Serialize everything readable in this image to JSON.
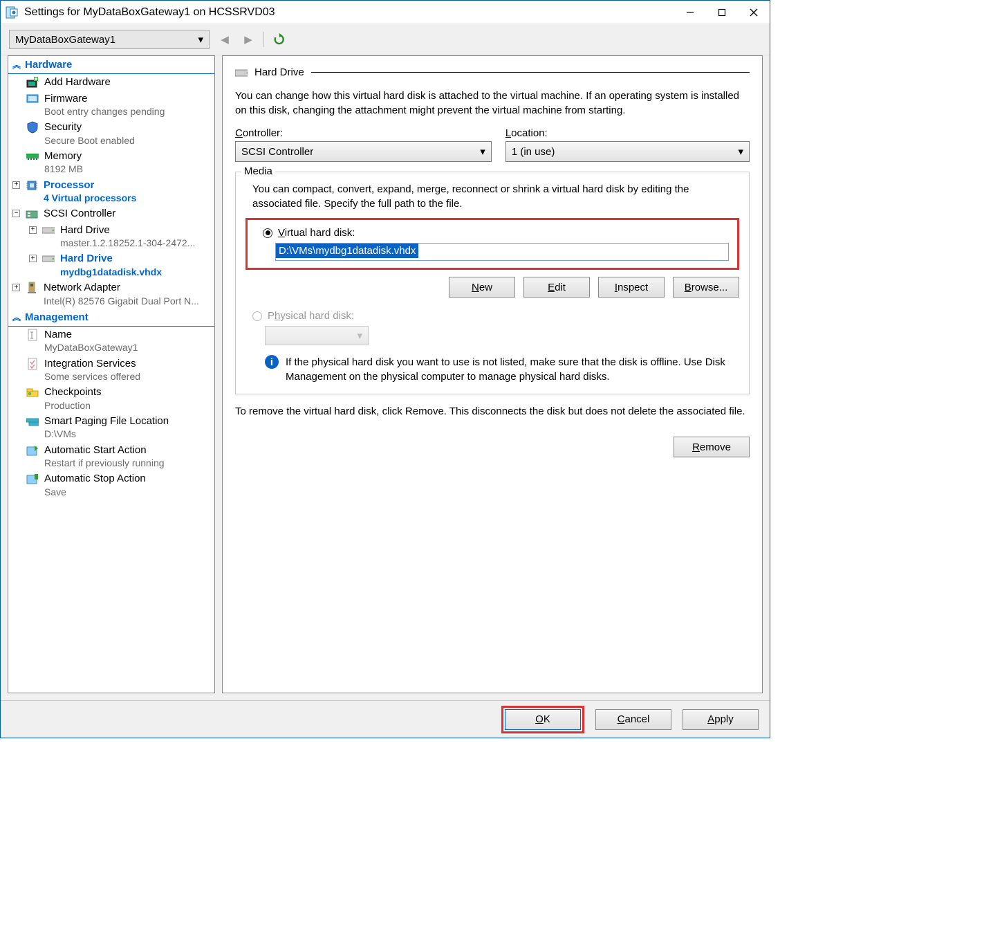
{
  "title": "Settings for MyDataBoxGateway1 on HCSSRVD03",
  "vm_selector": {
    "value": "MyDataBoxGateway1"
  },
  "sidebar": {
    "hardware_header": "Hardware",
    "management_header": "Management",
    "add_hardware": "Add Hardware",
    "firmware": {
      "label": "Firmware",
      "sub": "Boot entry changes pending"
    },
    "security": {
      "label": "Security",
      "sub": "Secure Boot enabled"
    },
    "memory": {
      "label": "Memory",
      "sub": "8192 MB"
    },
    "processor": {
      "label": "Processor",
      "sub": "4 Virtual processors"
    },
    "scsi": {
      "label": "SCSI Controller"
    },
    "hd1": {
      "label": "Hard Drive",
      "sub": "master.1.2.18252.1-304-2472..."
    },
    "hd2": {
      "label": "Hard Drive",
      "sub": "mydbg1datadisk.vhdx"
    },
    "network": {
      "label": "Network Adapter",
      "sub": "Intel(R) 82576 Gigabit Dual Port N..."
    },
    "name": {
      "label": "Name",
      "sub": "MyDataBoxGateway1"
    },
    "integration": {
      "label": "Integration Services",
      "sub": "Some services offered"
    },
    "checkpoints": {
      "label": "Checkpoints",
      "sub": "Production"
    },
    "smart_paging": {
      "label": "Smart Paging File Location",
      "sub": "D:\\VMs"
    },
    "auto_start": {
      "label": "Automatic Start Action",
      "sub": "Restart if previously running"
    },
    "auto_stop": {
      "label": "Automatic Stop Action",
      "sub": "Save"
    }
  },
  "main": {
    "section_title": "Hard Drive",
    "description": "You can change how this virtual hard disk is attached to the virtual machine. If an operating system is installed on this disk, changing the attachment might prevent the virtual machine from starting.",
    "controller_label": "Controller:",
    "controller_value": "SCSI Controller",
    "location_label": "Location:",
    "location_value": "1 (in use)",
    "media_legend": "Media",
    "media_desc": "You can compact, convert, expand, merge, reconnect or shrink a virtual hard disk by editing the associated file. Specify the full path to the file.",
    "vhd_radio": "Virtual hard disk:",
    "vhd_path": "D:\\VMs\\mydbg1datadisk.vhdx",
    "physical_radio": "Physical hard disk:",
    "info_text": "If the physical hard disk you want to use is not listed, make sure that the disk is offline. Use Disk Management on the physical computer to manage physical hard disks.",
    "remove_text": "To remove the virtual hard disk, click Remove. This disconnects the disk but does not delete the associated file.",
    "buttons": {
      "new": "New",
      "edit": "Edit",
      "inspect": "Inspect",
      "browse": "Browse...",
      "remove": "Remove"
    }
  },
  "footer": {
    "ok": "OK",
    "cancel": "Cancel",
    "apply": "Apply"
  }
}
